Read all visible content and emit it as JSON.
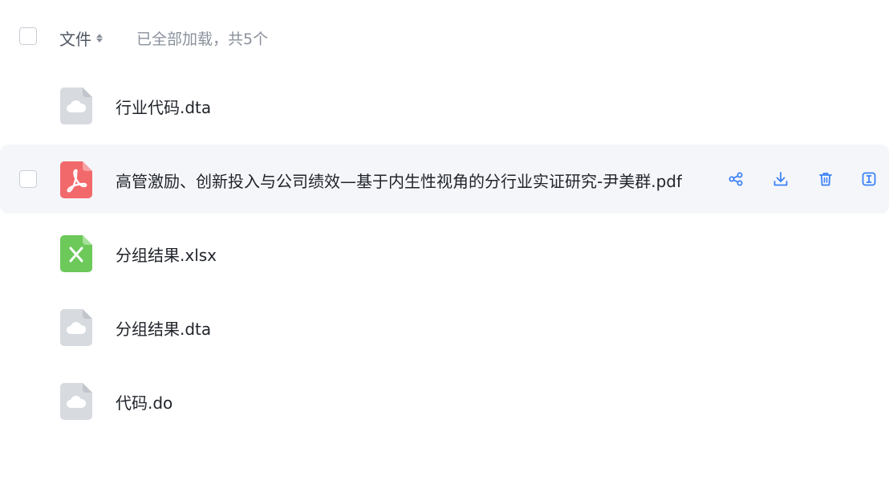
{
  "header": {
    "file_label": "文件",
    "status_text": "已全部加载，共5个"
  },
  "files": [
    {
      "name": "行业代码.dta",
      "type": "generic"
    },
    {
      "name": "高管激励、创新投入与公司绩效—基于内生性视角的分行业实证研究-尹美群.pdf",
      "type": "pdf"
    },
    {
      "name": "分组结果.xlsx",
      "type": "excel"
    },
    {
      "name": "分组结果.dta",
      "type": "generic"
    },
    {
      "name": "代码.do",
      "type": "generic"
    }
  ],
  "icons": {
    "generic": "cloud-file-icon",
    "pdf": "pdf-file-icon",
    "excel": "excel-file-icon",
    "share": "share-icon",
    "download": "download-icon",
    "delete": "trash-icon",
    "rename": "rename-icon"
  },
  "colors": {
    "accent": "#3b82f6",
    "hover_row_bg": "#f5f6fa",
    "pdf": "#f2696c",
    "excel": "#6cc95a",
    "generic": "#d7dadf"
  }
}
